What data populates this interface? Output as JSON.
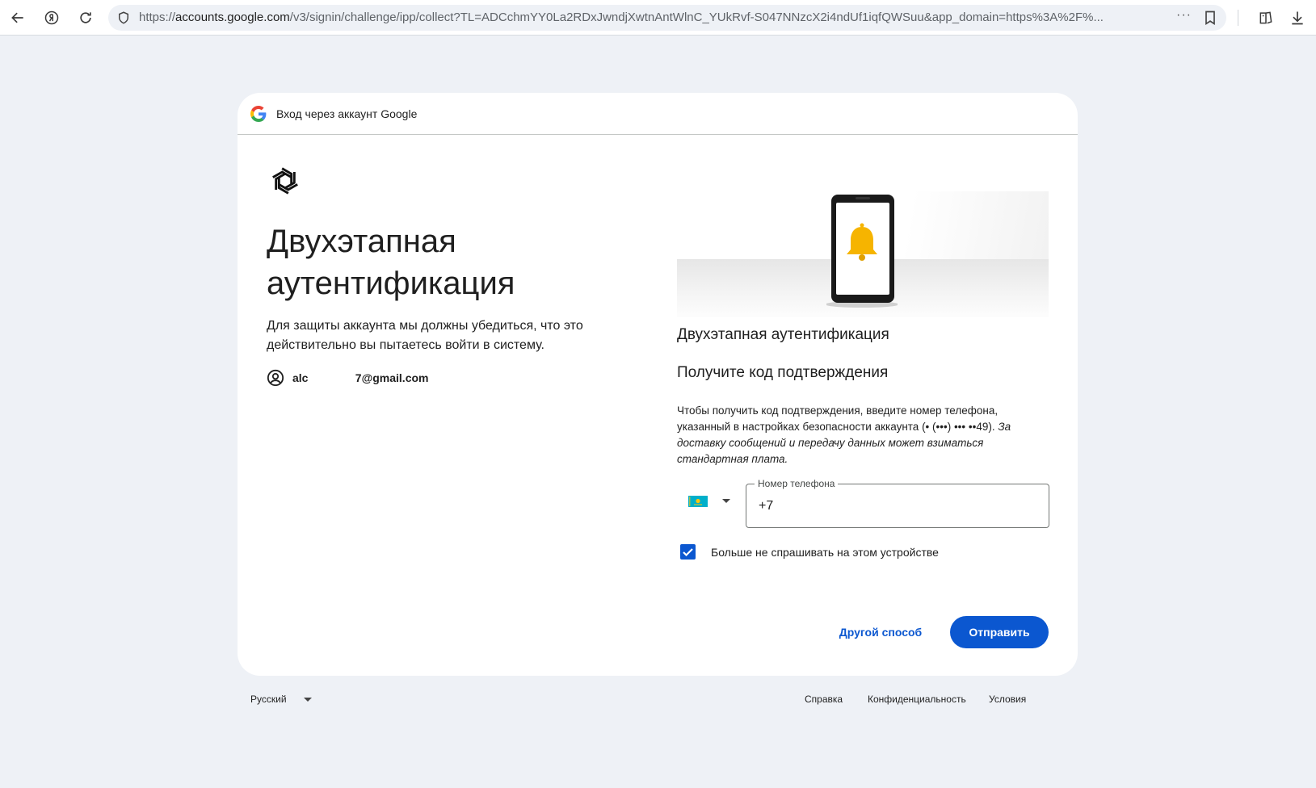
{
  "browser": {
    "url_scheme": "https://",
    "url_host": "accounts.google.com",
    "url_path": "/v3/signin/challenge/ipp/collect?TL=ADCchmYY0La2RDxJwndjXwtnAntWlnC_YUkRvf-S047NNzcX2i4ndUf1iqfQWSuu&app_domain=https%3A%2F%..."
  },
  "card": {
    "header_text": "Вход через аккаунт Google",
    "title": "Двухэтапная аутентификация",
    "subtitle": "Для защиты аккаунта мы должны убедиться, что это действительно вы пытаетесь войти в систему.",
    "account_email": "alc               7@gmail.com"
  },
  "challenge": {
    "title": "Двухэтапная аутентификация",
    "subtitle": "Получите код подтверждения",
    "info_plain": "Чтобы получить код подтверждения, введите номер телефона, указанный в настройках безопасности аккаунта (• (•••) ••• ••49). ",
    "info_italic": "За доставку сообщений и передачу данных может взиматься стандартная плата.",
    "phone_label": "Номер телефона",
    "phone_value": "+7",
    "remember_label": "Больше не спрашивать на этом устройстве",
    "remember_checked": true,
    "alt_button": "Другой способ",
    "send_button": "Отправить"
  },
  "footer": {
    "language": "Русский",
    "links": [
      "Справка",
      "Конфиденциальность",
      "Условия"
    ]
  },
  "colors": {
    "accent": "#0b57d0",
    "page_bg": "#eef1f6",
    "bell": "#f6b400"
  }
}
